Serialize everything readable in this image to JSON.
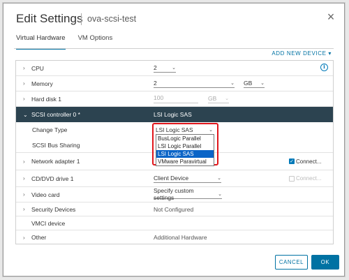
{
  "dialog": {
    "title": "Edit Settings",
    "subtitle": "ova-scsi-test",
    "close_glyph": "×"
  },
  "tabs": [
    {
      "label": "Virtual Hardware",
      "active": true
    },
    {
      "label": "VM Options",
      "active": false
    }
  ],
  "add_device_label": "ADD NEW DEVICE",
  "add_device_caret": "▾",
  "rows": {
    "cpu": {
      "label": "CPU",
      "value": "2"
    },
    "memory": {
      "label": "Memory",
      "value": "2",
      "unit": "GB"
    },
    "hard_disk": {
      "label": "Hard disk 1",
      "value": "100",
      "unit": "GB"
    },
    "scsi": {
      "label": "SCSI controller 0 *",
      "value": "LSI Logic SAS"
    },
    "change_type": {
      "label": "Change Type",
      "value": "LSI Logic SAS"
    },
    "bus_sharing": {
      "label": "SCSI Bus Sharing"
    },
    "network": {
      "label": "Network adapter 1",
      "connect_label": "Connect..."
    },
    "cddvd": {
      "label": "CD/DVD drive 1",
      "value": "Client Device",
      "connect_label": "Connect..."
    },
    "video": {
      "label": "Video card",
      "value": "Specify custom settings"
    },
    "security": {
      "label": "Security Devices",
      "value": "Not Configured"
    },
    "vmci": {
      "label": "VMCI device"
    },
    "other": {
      "label": "Other",
      "value": "Additional Hardware"
    }
  },
  "controller_options": [
    "BusLogic Parallel",
    "LSI Logic Parallel",
    "LSI Logic SAS",
    "VMware Paravirtual"
  ],
  "selected_option_index": 2,
  "icons": {
    "chevron_right": "›",
    "chevron_down": "⌄",
    "caret": "⌄",
    "info": "i",
    "check": "✓"
  },
  "buttons": {
    "cancel": "CANCEL",
    "ok": "OK"
  },
  "colors": {
    "accent": "#0072a3",
    "header_row": "#2c4350",
    "highlight_border": "#e0161b",
    "selected_option": "#0a64c7"
  }
}
